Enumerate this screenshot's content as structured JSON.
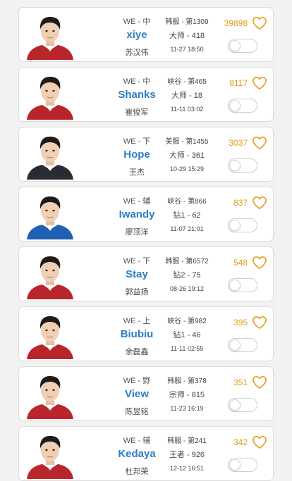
{
  "colors": {
    "nickname": "#2c7fc5",
    "likes": "#e0a020",
    "jersey_red": "#b8262c",
    "jersey_blue": "#1f5fb4"
  },
  "players": [
    {
      "team_pos": "WE - 中",
      "nickname": "xiye",
      "real_name": "苏汉伟",
      "server": "韩服 - 第1309",
      "rank": "大师 - 418",
      "time": "11-27 18:50",
      "likes": "39898",
      "jersey": "red",
      "heart_icon": "heart-outline-icon",
      "toggle_on": false
    },
    {
      "team_pos": "WE - 中",
      "nickname": "Shanks",
      "real_name": "崔悛军",
      "server": "峡谷 - 第465",
      "rank": "大师 - 18",
      "time": "11-11 03:02",
      "likes": "8117",
      "jersey": "red",
      "heart_icon": "heart-outline-icon",
      "toggle_on": false
    },
    {
      "team_pos": "WE - 下",
      "nickname": "Hope",
      "real_name": "王杰",
      "server": "美服 - 第1455",
      "rank": "大师 - 361",
      "time": "10-29 15:29",
      "likes": "3037",
      "jersey": "dark",
      "heart_icon": "heart-outline-icon",
      "toggle_on": false
    },
    {
      "team_pos": "WE - 辅",
      "nickname": "Iwandy",
      "real_name": "廖顶洋",
      "server": "峡谷 - 第866",
      "rank": "钻1 - 62",
      "time": "11-07 21:01",
      "likes": "837",
      "jersey": "blue",
      "heart_icon": "heart-outline-icon",
      "toggle_on": false
    },
    {
      "team_pos": "WE - 下",
      "nickname": "Stay",
      "real_name": "郭益扬",
      "server": "韩服 - 第6572",
      "rank": "钻2 - 75",
      "time": "08-26 19:12",
      "likes": "548",
      "jersey": "red",
      "heart_icon": "heart-outline-icon",
      "toggle_on": false
    },
    {
      "team_pos": "WE - 上",
      "nickname": "Biubiu",
      "real_name": "余磊鑫",
      "server": "峡谷 - 第982",
      "rank": "钻1 - 46",
      "time": "11-11 02:55",
      "likes": "395",
      "jersey": "red",
      "heart_icon": "heart-outline-icon",
      "toggle_on": false
    },
    {
      "team_pos": "WE - 野",
      "nickname": "View",
      "real_name": "陈昱铭",
      "server": "韩服 - 第378",
      "rank": "宗师 - 815",
      "time": "11-23 16:19",
      "likes": "351",
      "jersey": "red",
      "heart_icon": "heart-outline-icon",
      "toggle_on": false
    },
    {
      "team_pos": "WE - 辅",
      "nickname": "Kedaya",
      "real_name": "杜邦荣",
      "server": "韩服 - 第241",
      "rank": "王者 - 926",
      "time": "12-12 16:51",
      "likes": "342",
      "jersey": "red",
      "heart_icon": "heart-outline-icon",
      "toggle_on": false
    }
  ]
}
